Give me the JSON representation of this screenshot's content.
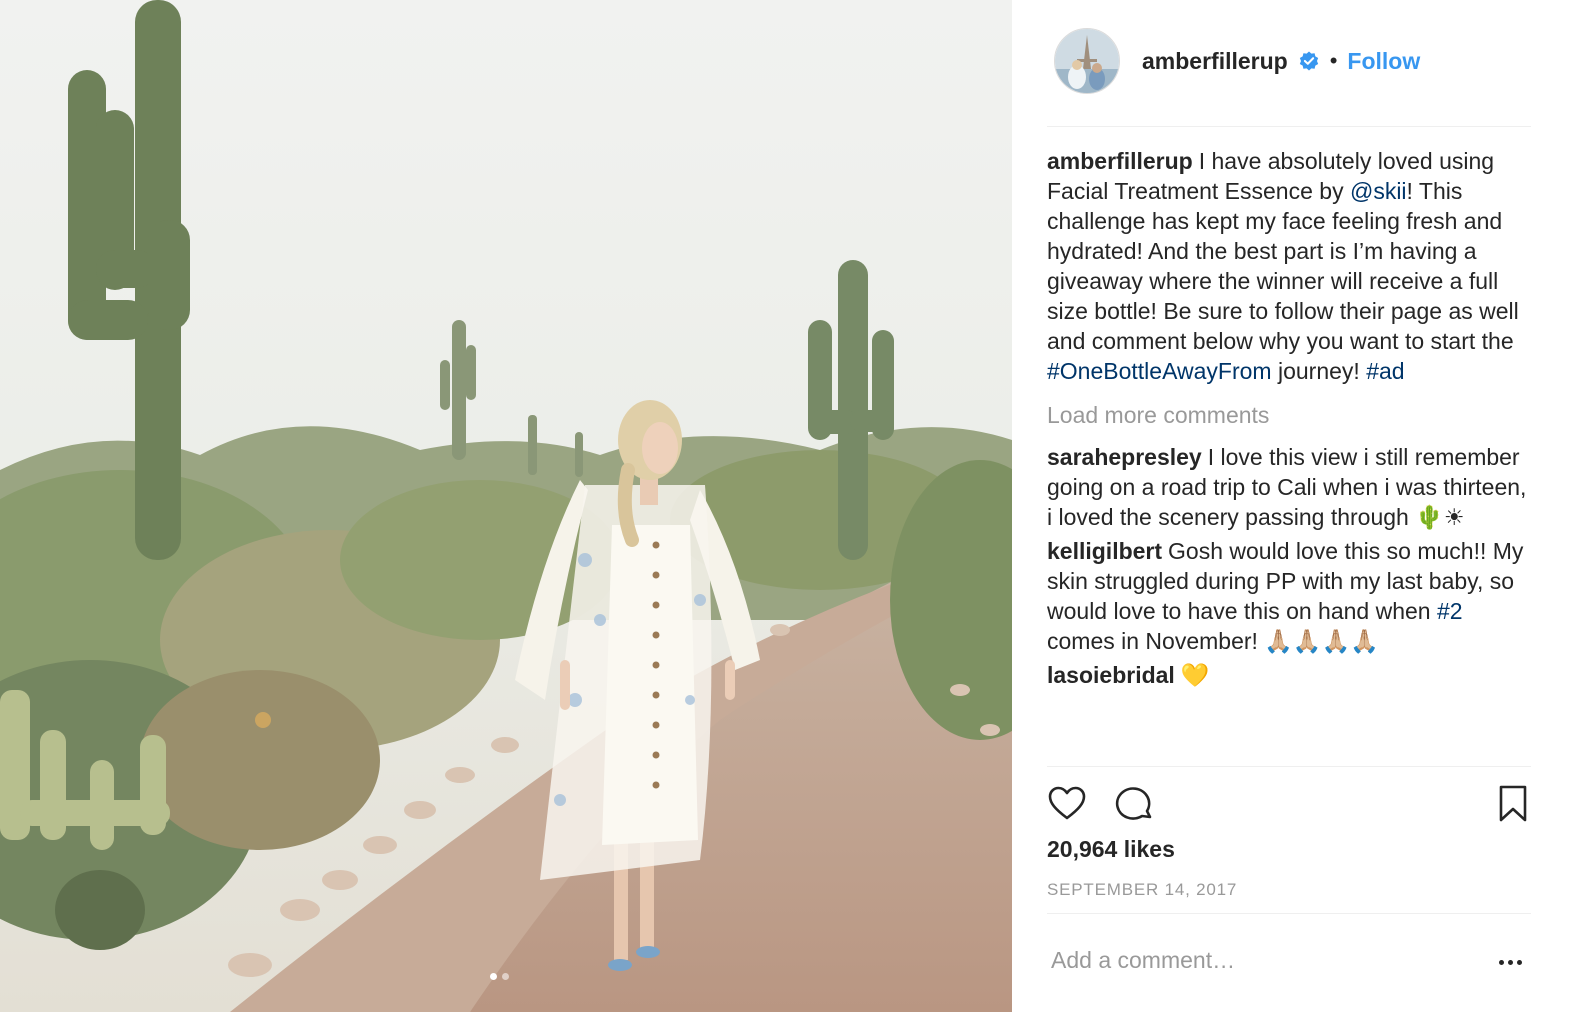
{
  "post": {
    "photo_alt": "Woman in white dress walking on a desert path with saguaro cacti",
    "carousel": {
      "count": 2,
      "active": 0
    }
  },
  "header": {
    "username": "amberfillerup",
    "verified_icon": "verified-badge-icon",
    "separator": "•",
    "follow_label": "Follow"
  },
  "caption": {
    "user": "amberfillerup",
    "text_1": "I have absolutely loved using Facial Treatment Essence by ",
    "mention": "@skii",
    "text_2": "! This challenge has kept my face feeling fresh and hydrated! And the best part is I’m having a giveaway where the winner will receive a full size bottle!  Be sure to follow their page as well and comment below why you want to start the ",
    "hashtag_1": "#OneBottleAwayFrom",
    "text_3": " journey! ",
    "hashtag_2": "#ad"
  },
  "load_more": "Load more comments",
  "comments": [
    {
      "user": "sarahepresley",
      "text": "I love this view i still remember going on a road trip to Cali when i was thirteen, i loved the scenery passing through 🌵☀"
    },
    {
      "user": "kelligilbert",
      "text_1": "Gosh would love this so much!! My skin struggled during PP with my last baby, so would love to have this on hand when ",
      "hashtag": "#2",
      "text_2": " comes in November! 🙏🏼🙏🏼🙏🏼🙏🏼"
    },
    {
      "user": "lasoiebridal",
      "text": "💛"
    }
  ],
  "actions": {
    "like_icon": "heart-icon",
    "comment_icon": "comment-bubble-icon",
    "save_icon": "bookmark-icon"
  },
  "likes": "20,964 likes",
  "timestamp": "SEPTEMBER 14, 2017",
  "add_comment": {
    "placeholder": "Add a comment…"
  },
  "more_icon": "more-options-icon",
  "colors": {
    "link_blue": "#3897f0",
    "mention": "#003569",
    "muted": "#999999",
    "text": "#262626"
  }
}
